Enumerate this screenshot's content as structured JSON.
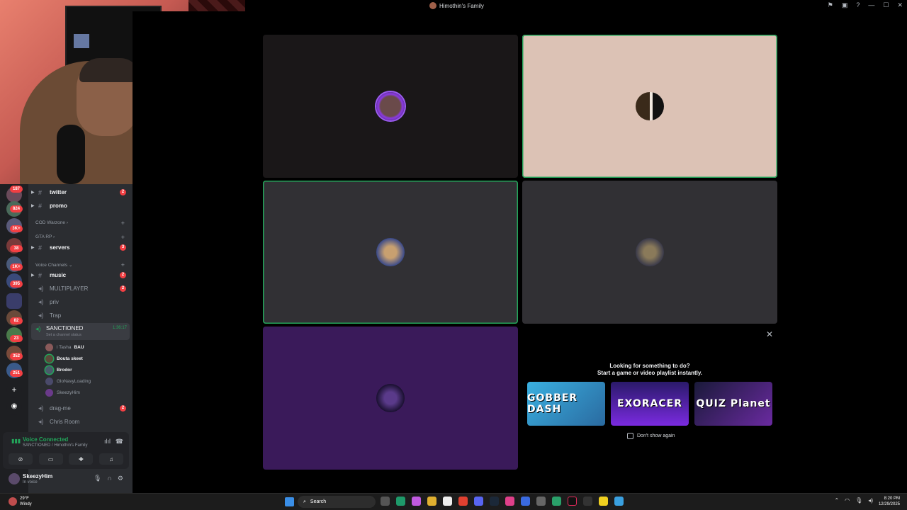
{
  "window": {
    "title": "Himothin's Family"
  },
  "server_rail": [
    {
      "badge": "187",
      "icon": "server-icon"
    },
    {
      "badge": "824",
      "icon": "server-icon"
    },
    {
      "badge": "3K+",
      "icon": "server-icon"
    },
    {
      "badge": "38",
      "icon": "server-icon"
    },
    {
      "badge": "1K+",
      "icon": "server-icon"
    },
    {
      "badge": "395",
      "icon": "server-icon"
    },
    {
      "badge": "",
      "icon": "folder-icon"
    },
    {
      "badge": "82",
      "icon": "server-icon"
    },
    {
      "badge": "23",
      "icon": "server-icon"
    },
    {
      "badge": "352",
      "icon": "server-icon"
    },
    {
      "badge": "251",
      "icon": "server-icon"
    },
    {
      "badge": "",
      "icon": "add-server-icon"
    },
    {
      "badge": "",
      "icon": "discover-icon"
    }
  ],
  "channels": {
    "twitter": {
      "label": "twitter",
      "count": "2"
    },
    "promo": {
      "label": "promo"
    },
    "cat_cod": {
      "label": "COD Warzone"
    },
    "cat_gta": {
      "label": "GTA RP"
    },
    "servers": {
      "label": "servers",
      "count": "3"
    },
    "cat_voice": {
      "label": "Voice Channels"
    },
    "music": {
      "label": "music",
      "count": "2"
    },
    "multiplayer": {
      "label": "MULTIPLAYER",
      "count": "2"
    },
    "priv": {
      "label": "priv"
    },
    "trap": {
      "label": "Trap"
    },
    "sanctioned": {
      "label": "SANCTIONED",
      "timer": "1:36:17",
      "status_placeholder": "Set a channel status"
    },
    "drag_me": {
      "label": "drag-me",
      "count": "2"
    },
    "chris_room": {
      "label": "Chris Room"
    }
  },
  "members": [
    {
      "name": "l Tasha",
      "tag": "BAU"
    },
    {
      "name": "Bouta skeet"
    },
    {
      "name": "Brodor"
    },
    {
      "name": "GloNavyLoading"
    },
    {
      "name": "SkeezyHim"
    }
  ],
  "voice": {
    "status": "Voice Connected",
    "location": "SANCTIONED / Himothin's Family"
  },
  "user": {
    "name": "SkeezyHim",
    "status": "In voice"
  },
  "activity": {
    "line1": "Looking for something to do?",
    "line2": "Start a game or video playlist instantly.",
    "games": [
      "GOBBER DASH",
      "EXORACER",
      "QUIZ Planet"
    ],
    "dont_show": "Don't show again"
  },
  "colors": {
    "speaking": "#23a55a",
    "tile_peach": "#dcc2b5",
    "tile_purple": "#3a1a5a",
    "tile_gray": "#313034"
  },
  "taskbar": {
    "temp": "29°F",
    "weather": "Windy",
    "search_placeholder": "Search",
    "time": "8:20 PM",
    "date": "12/29/2025"
  }
}
